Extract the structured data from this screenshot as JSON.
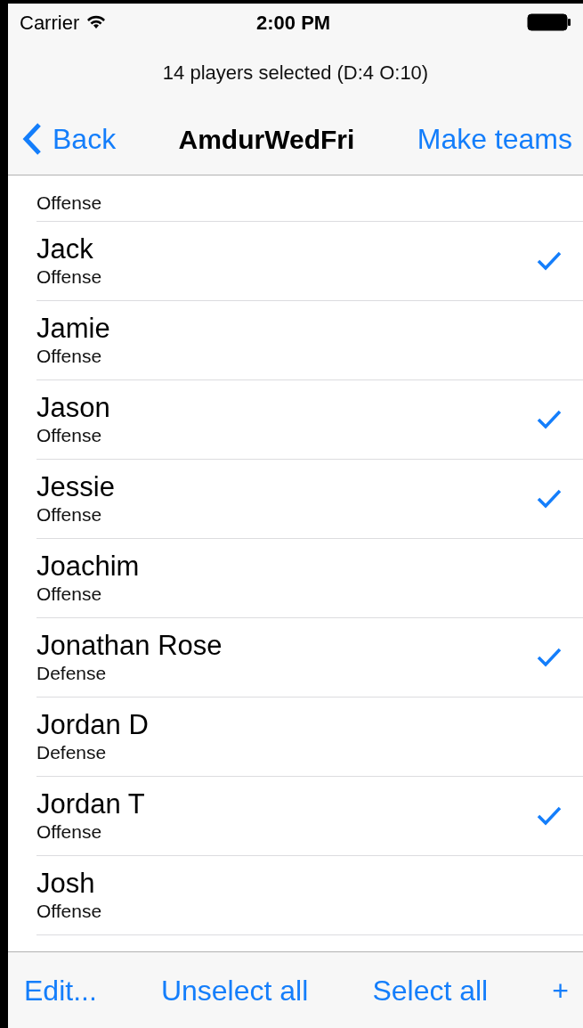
{
  "status_bar": {
    "carrier": "Carrier",
    "time": "2:00 PM"
  },
  "prompt": "14 players selected (D:4 O:10)",
  "nav": {
    "back": "Back",
    "title": "AmdurWedFri",
    "action": "Make teams"
  },
  "players": [
    {
      "position": "Offense",
      "checked": false
    },
    {
      "name": "Jack",
      "position": "Offense",
      "checked": true
    },
    {
      "name": "Jamie",
      "position": "Offense",
      "checked": false
    },
    {
      "name": "Jason",
      "position": "Offense",
      "checked": true
    },
    {
      "name": "Jessie",
      "position": "Offense",
      "checked": true
    },
    {
      "name": "Joachim",
      "position": "Offense",
      "checked": false
    },
    {
      "name": "Jonathan Rose",
      "position": "Defense",
      "checked": true
    },
    {
      "name": "Jordan D",
      "position": "Defense",
      "checked": false
    },
    {
      "name": "Jordan T",
      "position": "Offense",
      "checked": true
    },
    {
      "name": "Josh",
      "position": "Offense",
      "checked": false
    }
  ],
  "toolbar": [
    "Edit...",
    "Unselect all",
    "Select all",
    "+"
  ]
}
